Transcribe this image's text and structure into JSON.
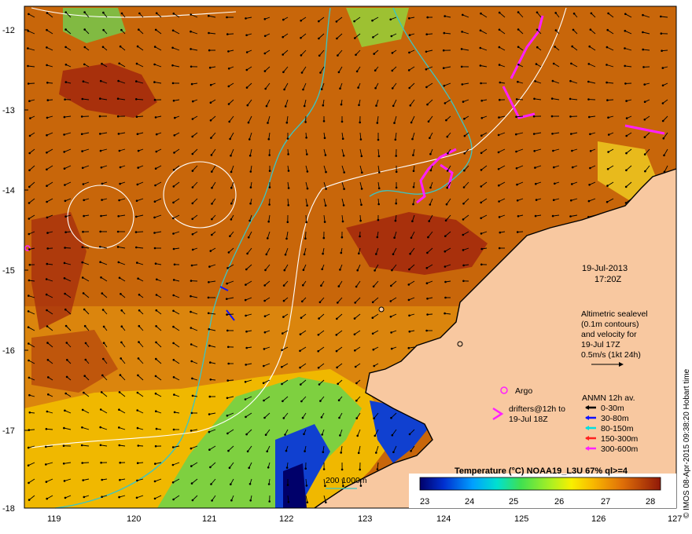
{
  "map": {
    "y_ticks": [
      "-12",
      "-13",
      "-14",
      "-15",
      "-16",
      "-17",
      "-18"
    ],
    "x_ticks": [
      "119",
      "120",
      "121",
      "122",
      "123",
      "124",
      "125",
      "126",
      "127"
    ],
    "date": "19-Jul-2013",
    "time": "17:20Z",
    "altimetry_note": [
      "Altimetric sealevel",
      "(0.1m contours)",
      "and velocity for",
      "19-Jul 17Z",
      "0.5m/s (1kt 24h)"
    ],
    "argo_label": "Argo",
    "drifters_label": [
      "drifters@12h to",
      "19-Jul 18Z"
    ],
    "anmn_title": "ANMN 12h av.",
    "anmn_depths": [
      {
        "label": "0-30m",
        "color": "#000000"
      },
      {
        "label": "30-80m",
        "color": "#1010ff"
      },
      {
        "label": "80-150m",
        "color": "#00e0e0"
      },
      {
        "label": "150-300m",
        "color": "#ff2020"
      },
      {
        "label": "300-600m",
        "color": "#ff20ff"
      }
    ],
    "depth_contours_label": "200  1000m",
    "colorbar_title": "Temperature (°C) NOAA19_L3U 67% ql>=4",
    "colorbar_ticks": [
      "23",
      "24",
      "25",
      "26",
      "27",
      "28"
    ],
    "credit": "© IMOS 08-Apr-2015 09:38:20 Hobart time",
    "colors": {
      "sea_warm": "#c8660a",
      "sea_hot": "#a8300c",
      "sea_mid": "#e2900f",
      "land": "#f8c8a0",
      "altimetry_contour": "#ffffff",
      "bathymetry_contour": "#39c6c6",
      "drifter": "#ff20ff"
    }
  }
}
